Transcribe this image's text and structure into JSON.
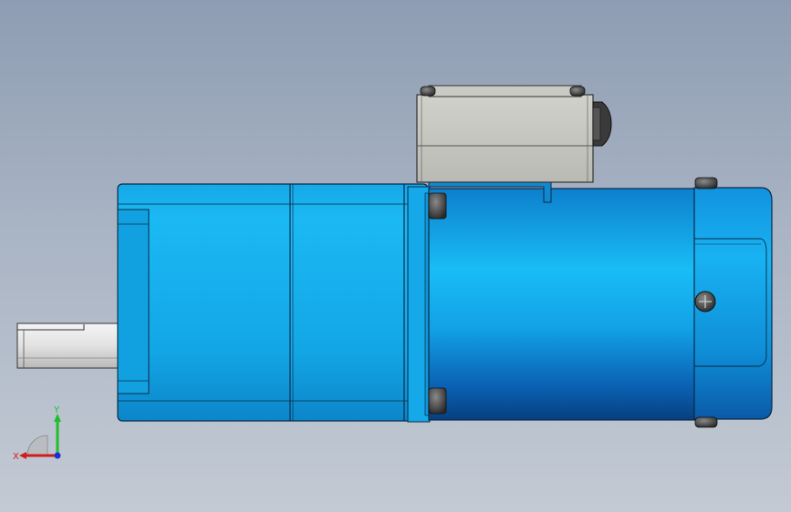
{
  "triad": {
    "x_label": "X",
    "y_label": "Y",
    "colors": {
      "x": "#d21c1c",
      "y": "#1fbf2a",
      "z": "#1a2fd6"
    }
  },
  "model": {
    "colors": {
      "body_blue": "#18b9f2",
      "body_blue_dark": "#0a5fa8",
      "terminal_box": "#c6c7c0",
      "shaft": "#e6e6e6"
    }
  }
}
